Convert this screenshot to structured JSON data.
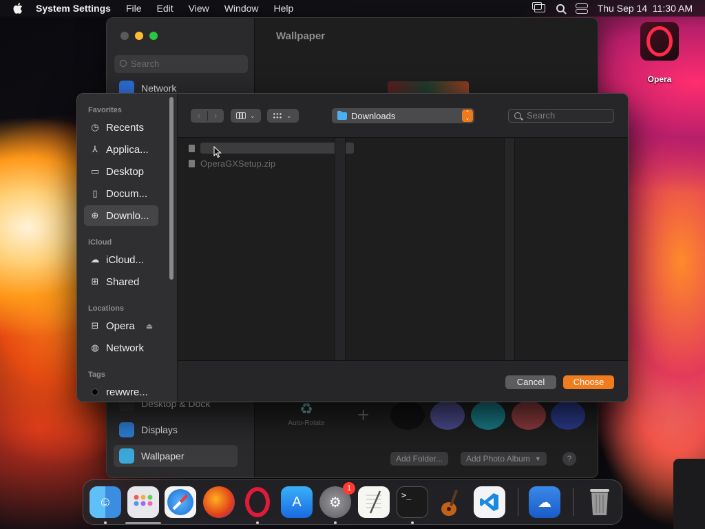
{
  "menubar": {
    "app_name": "System Settings",
    "menus": [
      "File",
      "Edit",
      "View",
      "Window",
      "Help"
    ],
    "clock": "Thu Sep 14  11:30 AM"
  },
  "desktop": {
    "opera_label": "Opera"
  },
  "settings_window": {
    "search_placeholder": "Search",
    "title": "Wallpaper",
    "sidebar": {
      "network": "Network",
      "desktop_dock": "Desktop & Dock",
      "displays": "Displays",
      "wallpaper": "Wallpaper"
    },
    "auto_rotate": "Auto-Rotate",
    "add_folder": "Add Folder...",
    "add_photo_album": "Add Photo Album",
    "help": "?"
  },
  "dialog": {
    "sections": {
      "favorites": "Favorites",
      "icloud": "iCloud",
      "locations": "Locations",
      "tags": "Tags"
    },
    "favorites": [
      {
        "label": "Recents",
        "icon": "clock-icon"
      },
      {
        "label": "Applica...",
        "icon": "applications-icon"
      },
      {
        "label": "Desktop",
        "icon": "desktop-icon"
      },
      {
        "label": "Docum...",
        "icon": "document-icon"
      },
      {
        "label": "Downlo...",
        "icon": "download-icon"
      }
    ],
    "icloud": [
      {
        "label": "iCloud...",
        "icon": "cloud-icon"
      },
      {
        "label": "Shared",
        "icon": "shared-folder-icon"
      }
    ],
    "locations": [
      {
        "label": "Opera",
        "icon": "drive-icon"
      },
      {
        "label": "Network",
        "icon": "globe-icon"
      }
    ],
    "tags": [
      {
        "label": "rewwre...",
        "color": "#000000"
      }
    ],
    "location_popup": "Downloads",
    "search_placeholder": "Search",
    "files": [
      "",
      "OperaGXSetup.zip"
    ],
    "cancel": "Cancel",
    "choose": "Choose"
  },
  "dock": {
    "settings_badge": "1"
  },
  "colors": {
    "accent": "#f07c1e",
    "folder": "#4ab0f0",
    "badge": "#ff3b30"
  }
}
